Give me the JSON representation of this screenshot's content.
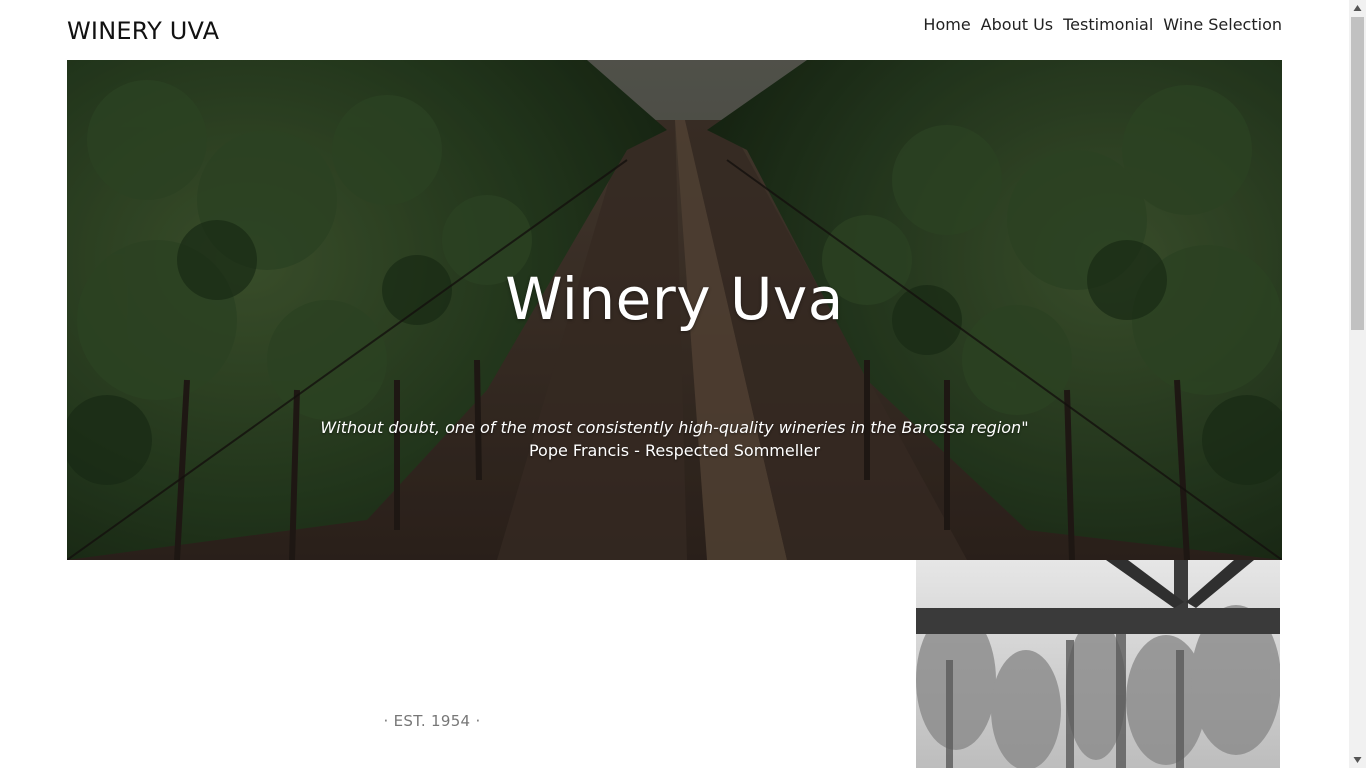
{
  "header": {
    "brand": "WINERY UVA",
    "nav": [
      "Home",
      "About Us",
      "Testimonial",
      "Wine Selection"
    ]
  },
  "hero": {
    "title": "Winery Uva",
    "quote": "Without doubt, one of the most consistently high-quality wineries in the Barossa region\"",
    "author": "Pope Francis - Respected Sommeller"
  },
  "about": {
    "established": "· EST. 1954 ·"
  },
  "icons": {
    "scroll_up": "triangle-up-icon",
    "scroll_down": "triangle-down-icon"
  },
  "colors": {
    "text": "#222222",
    "muted": "#777777",
    "vine_green": "#2f4a26"
  }
}
